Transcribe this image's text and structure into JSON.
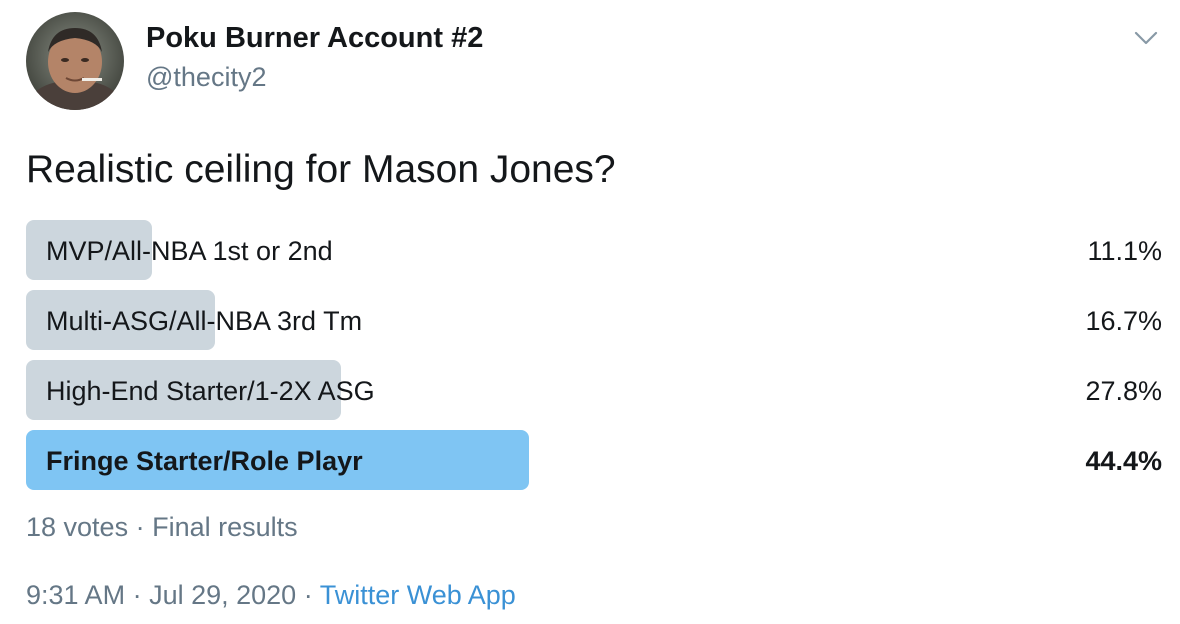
{
  "user": {
    "display_name": "Poku Burner Account #2",
    "handle": "@thecity2",
    "avatar_icon": "profile-photo"
  },
  "tweet": {
    "text": "Realistic ceiling for Mason Jones?"
  },
  "poll": {
    "options": [
      {
        "label": "MVP/All-NBA 1st or 2nd",
        "percent_text": "11.1%",
        "percent": 11.1,
        "winner": false
      },
      {
        "label": "Multi-ASG/All-NBA 3rd Tm",
        "percent_text": "16.7%",
        "percent": 16.7,
        "winner": false
      },
      {
        "label": "High-End Starter/1-2X ASG",
        "percent_text": "27.8%",
        "percent": 27.8,
        "winner": false
      },
      {
        "label": "Fringe Starter/Role Playr",
        "percent_text": "44.4%",
        "percent": 44.4,
        "winner": true
      }
    ],
    "votes": "18 votes",
    "separator": " · ",
    "status": "Final results"
  },
  "meta": {
    "time": "9:31 AM",
    "separator": " · ",
    "date": "Jul 29, 2020",
    "source": "Twitter Web App"
  },
  "colors": {
    "bar_default": "#ccd6dd",
    "bar_winner": "#7fc5f3",
    "secondary_text": "#657786",
    "link": "#3a91d5"
  }
}
